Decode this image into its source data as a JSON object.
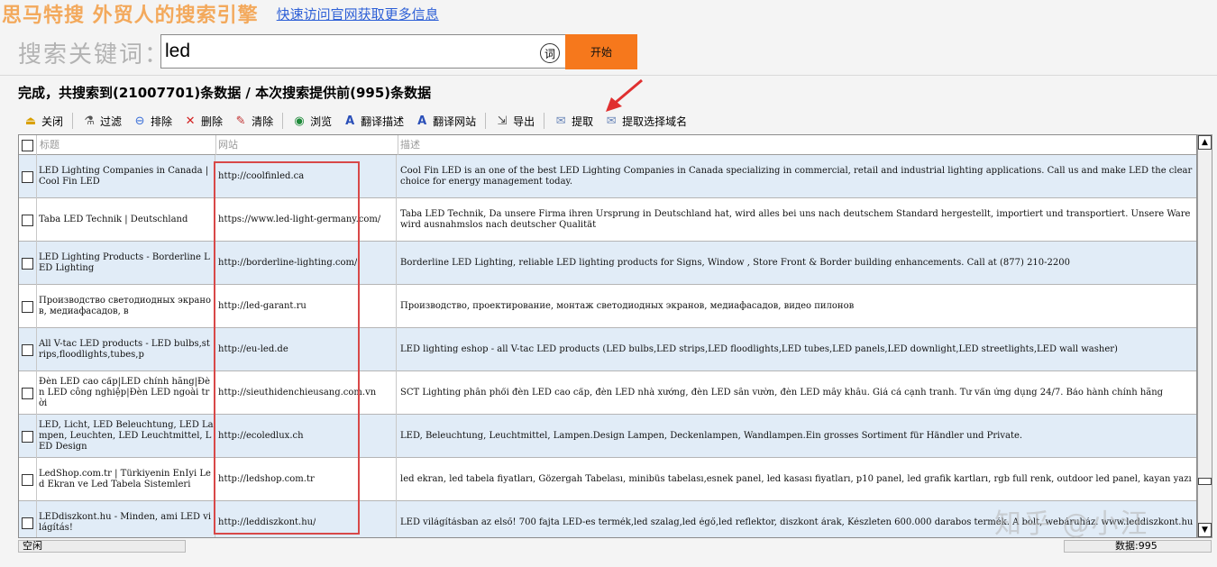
{
  "header": {
    "brand": "思马特搜 外贸人的搜索引擎",
    "link": "快速访问官网获取更多信息"
  },
  "search": {
    "label": "搜索关键词：",
    "value": "led",
    "ci_icon_label": "词",
    "button": "开始"
  },
  "status": "完成，共搜索到(21007701)条数据 / 本次搜索提供前(995)条数据",
  "toolbar": [
    {
      "label": "关闭",
      "icon": "close-app-icon",
      "color": "#d9a000"
    },
    {
      "label": "过滤",
      "icon": "filter-icon",
      "color": "#555555"
    },
    {
      "label": "排除",
      "icon": "exclude-icon",
      "color": "#3a6fd8"
    },
    {
      "label": "删除",
      "icon": "delete-icon",
      "color": "#d22020"
    },
    {
      "label": "清除",
      "icon": "clear-icon",
      "color": "#c03030"
    },
    {
      "label": "浏览",
      "icon": "globe-icon",
      "color": "#1e8a3a"
    },
    {
      "label": "翻译描述",
      "icon": "translate-icon",
      "color": "#2a4fb8"
    },
    {
      "label": "翻译网站",
      "icon": "translate-icon",
      "color": "#2a4fb8"
    },
    {
      "label": "导出",
      "icon": "export-icon",
      "color": "#4a4a4a"
    },
    {
      "label": "提取",
      "icon": "extract-icon",
      "color": "#6a86b8"
    },
    {
      "label": "提取选择域名",
      "icon": "extract-domain-icon",
      "color": "#6a86b8"
    }
  ],
  "columns": [
    "标题",
    "网站",
    "描述"
  ],
  "rows": [
    {
      "title": "LED Lighting Companies in Canada | Cool Fin LED",
      "site": "http://coolfinled.ca",
      "desc": "Cool Fin LED is an one of the best LED Lighting Companies in Canada specializing in commercial, retail and industrial lighting applications. Call us and make LED the clear choice for energy management today."
    },
    {
      "title": "Taba LED Technik | Deutschland",
      "site": "https://www.led-light-germany.com/",
      "desc": "Taba LED Technik, Da unsere Firma ihren Ursprung in Deutschland hat, wird alles bei uns nach deutschem Standard hergestellt, importiert und transportiert. Unsere Ware wird ausnahmslos nach deutscher Qualität"
    },
    {
      "title": "LED Lighting Products - Borderline LED Lighting",
      "site": "http://borderline-lighting.com/",
      "desc": "Borderline LED Lighting, reliable LED lighting products for Signs, Window , Store Front & Border building enhancements. Call at (877) 210-2200"
    },
    {
      "title": "Производство светодиодных экранов, медиафасадов, в",
      "site": "http://led-garant.ru",
      "desc": "Производство, проектирование, монтаж светодиодных экранов, медиафасадов, видео пилонов"
    },
    {
      "title": "All V-tac LED products - LED bulbs,strips,floodlights,tubes,p",
      "site": "http://eu-led.de",
      "desc": "LED lighting eshop - all V-tac LED products (LED bulbs,LED strips,LED floodlights,LED tubes,LED panels,LED downlight,LED streetlights,LED wall washer)"
    },
    {
      "title": "Đèn LED cao cấp|LED chính hãng|Đèn LED công nghiệp|Đèn LED ngoài trời",
      "site": "http://sieuthidenchieusang.com.vn",
      "desc": "SCT Lighting phân phối đèn LED cao cấp, đèn LED nhà xưởng, đèn LED sân vườn, đèn LED mây khâu. Giá cả cạnh tranh. Tư vấn ứng dụng 24/7. Bảo hành chính hãng"
    },
    {
      "title": "LED, Licht, LED Beleuchtung, LED Lampen, Leuchten, LED Leuchtmittel, LED Design",
      "site": "http://ecoledlux.ch",
      "desc": "LED, Beleuchtung, Leuchtmittel, Lampen.Design Lampen, Deckenlampen, Wandlampen.Ein grosses Sortiment für Händler und Private."
    },
    {
      "title": "LedShop.com.tr | Türkiyenin Enİyi Led Ekran ve Led Tabela Sistemleri",
      "site": "http://ledshop.com.tr",
      "desc": "led ekran, led tabela fiyatları, Gözergah Tabelası, minibüs tabelası,esnek panel, led kasası fiyatları, p10 panel, led grafik kartları, rgb full renk, outdoor led panel, kayan yazı"
    },
    {
      "title": "LEDdiszkont.hu - Minden, ami LED világítás!",
      "site": "http://leddiszkont.hu/",
      "desc": "LED világításban az első! 700 fajta LED-es termék,led szalag,led égő,led reflektor, diszkont árak, Készleten 600.000 darabos termék. A bolt, webáruház. www.leddiszkont.hu"
    }
  ],
  "statusbar": {
    "left": "空闲",
    "right": "数据:995"
  },
  "watermark": "知乎 @小汪"
}
